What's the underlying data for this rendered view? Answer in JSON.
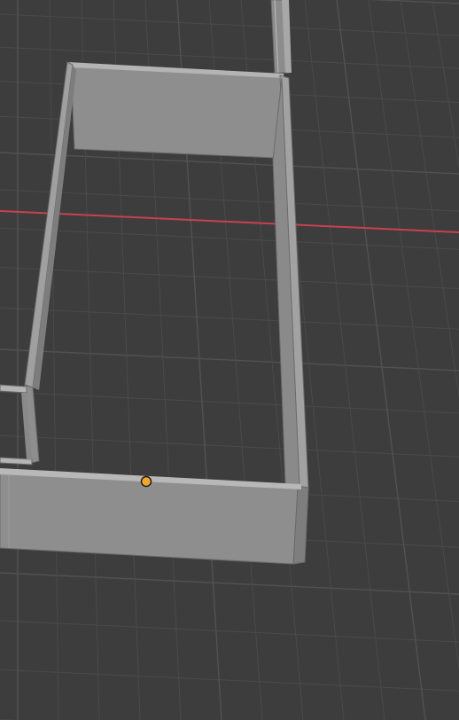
{
  "viewport": {
    "view": "3D perspective",
    "grid": true,
    "background_color": "#3d3d3d",
    "grid_line_color": "#4a4a4a",
    "grid_major_color": "#525252",
    "x_axis_color": "#c8414f"
  },
  "scene": {
    "objects": [
      {
        "name": "wall-back",
        "type": "wall"
      },
      {
        "name": "wall-right",
        "type": "wall"
      },
      {
        "name": "wall-left",
        "type": "wall"
      },
      {
        "name": "wall-front",
        "type": "wall"
      },
      {
        "name": "wall-far-segment",
        "type": "wall"
      },
      {
        "name": "wall-stub-left",
        "type": "wall"
      }
    ],
    "wall_face_color": "#8e8e8e",
    "wall_top_color": "#b4b4b4",
    "wall_edge_color": "#6a6a6a"
  },
  "gizmo": {
    "origin_point": {
      "color": "#f5a623",
      "outline": "#1e1e1e"
    }
  }
}
